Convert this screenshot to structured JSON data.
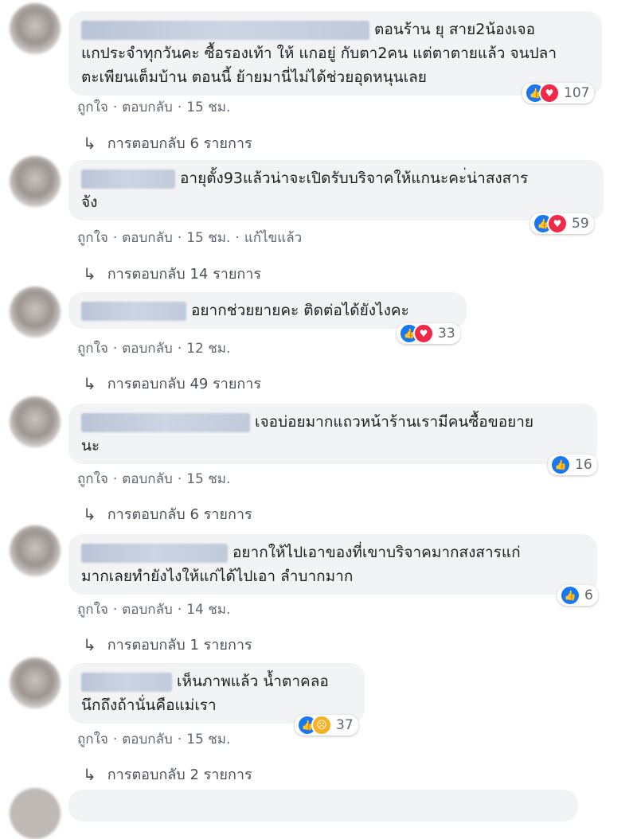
{
  "comments": [
    {
      "text_line1": "ตอนร้าน ยุ สาย2น้องเจอ",
      "text_rest": "แกประจำทุกวันคะ ซื้อรองเท้า ให้ แกอยู่ กับตา2คน แต่ตาตายแล้ว จนปลาตะเพียนเต็มบ้าน ตอนนี้ ย้ายมานี่ไม่ได้ช่วยอุดหนุนเลย",
      "reaction_count": "107",
      "reactions": [
        "like",
        "love"
      ],
      "like_label": "ถูกใจ",
      "reply_label": "ตอบกลับ",
      "time": "15 ชม.",
      "edited": "",
      "replies_text": "การตอบกลับ 6 รายการ"
    },
    {
      "text_line1": "อายุตั้ง93แล้วน่าจะเปิดรับบริจาคให้แกนะคะ่น่าสงสาร",
      "text_rest": "จัง",
      "reaction_count": "59",
      "reactions": [
        "like",
        "love"
      ],
      "like_label": "ถูกใจ",
      "reply_label": "ตอบกลับ",
      "time": "15 ชม.",
      "edited": "แก้ไขแล้ว",
      "replies_text": "การตอบกลับ 14 รายการ"
    },
    {
      "text_line1": "อยากช่วยยายคะ ติดต่อได้ยังไงคะ",
      "text_rest": "",
      "reaction_count": "33",
      "reactions": [
        "like",
        "love"
      ],
      "like_label": "ถูกใจ",
      "reply_label": "ตอบกลับ",
      "time": "12 ชม.",
      "edited": "",
      "replies_text": "การตอบกลับ 49 รายการ"
    },
    {
      "text_line1": "เจอบ่อยมากแถวหน้าร้านเรามีคนซื้อขอยาย",
      "text_rest": "นะ",
      "reaction_count": "16",
      "reactions": [
        "like"
      ],
      "like_label": "ถูกใจ",
      "reply_label": "ตอบกลับ",
      "time": "15 ชม.",
      "edited": "",
      "replies_text": "การตอบกลับ 6 รายการ"
    },
    {
      "text_line1": "อยากให้ไปเอาของที่เขาบริจาคมากสงสารแก่",
      "text_rest": "มากเลยทำยังไงให้แก่ได้ไปเอา ลำบากมาก",
      "reaction_count": "6",
      "reactions": [
        "like"
      ],
      "like_label": "ถูกใจ",
      "reply_label": "ตอบกลับ",
      "time": "14 ชม.",
      "edited": "",
      "replies_text": "การตอบกลับ 1 รายการ"
    },
    {
      "text_line1": "เห็นภาพแล้ว น้ำตาคลอ",
      "text_rest": "นึกถึงถ้านั่นคือแม่เรา",
      "reaction_count": "37",
      "reactions": [
        "like",
        "sad"
      ],
      "like_label": "ถูกใจ",
      "reply_label": "ตอบกลับ",
      "time": "15 ชม.",
      "edited": "",
      "replies_text": "การตอบกลับ 2 รายการ"
    }
  ],
  "colors": {
    "like": "#1877f2",
    "love": "#f0284a",
    "sad": "#f7b125",
    "bubble": "#f2f3f5"
  },
  "icons": {
    "like": "thumbs-up-icon",
    "love": "heart-icon",
    "sad": "sad-face-icon",
    "reply_arrow": "reply-arrow-icon"
  }
}
